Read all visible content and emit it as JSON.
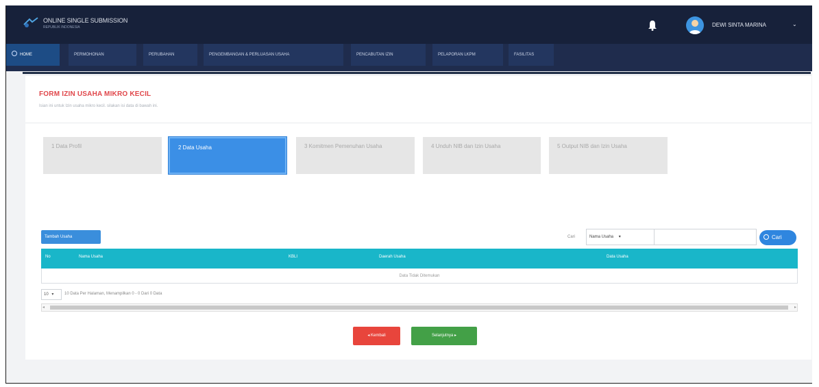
{
  "header": {
    "logo_title": "ONLINE SINGLE SUBMISSION",
    "logo_subtitle": "REPUBLIK INDONESIA",
    "user_name": "DEWI SINTA MARINA",
    "user_caret": "⌄"
  },
  "nav": {
    "items": [
      {
        "label": "HOME"
      },
      {
        "label": "PERMOHONAN"
      },
      {
        "label": "PERUBAHAN"
      },
      {
        "label": "PENGEMBANGAN & PERLUASAN USAHA"
      },
      {
        "label": "PENCABUTAN IZIN"
      },
      {
        "label": "PELAPORAN LKPM"
      },
      {
        "label": "FASILITAS"
      }
    ]
  },
  "form": {
    "title": "FORM IZIN USAHA MIKRO KECIL",
    "subtitle": "Isian ini untuk Izin usaha mikro kecil. silakan isi data di bawah ini."
  },
  "steps": [
    {
      "label": "1 Data Profil",
      "active": false
    },
    {
      "label": "2 Data Usaha",
      "active": true
    },
    {
      "label": "3 Komitmen Pemenuhan Usaha",
      "active": false
    },
    {
      "label": "4 Unduh NIB dan Izin Usaha",
      "active": false
    },
    {
      "label": "5 Output NIB dan Izin Usaha",
      "active": false
    }
  ],
  "toolbar": {
    "add_label": "Tambah Usaha",
    "search_label": "Cari",
    "search_select": "Nama Usaha",
    "search_select_caret": "▾",
    "search_placeholder": "",
    "search_button": "Cari"
  },
  "table": {
    "columns": [
      "No",
      "Nama Usaha",
      "KBLI",
      "Daerah Usaha",
      "Data Usaha"
    ],
    "empty_text": "Data Tidak Ditemukan"
  },
  "pager": {
    "page_size": "10",
    "page_size_caret": "▾",
    "info": "10 Data Per Halaman, Menampilkan 0 - 0 Dari 0 Data",
    "scroll_left": "◂",
    "scroll_right": "▸"
  },
  "actions": {
    "back_label": "◂ Kembali",
    "next_label": "Selanjutnya ▸"
  },
  "colors": {
    "topbar": "#17213a",
    "navbar": "#1f2c4d",
    "title_red": "#e0464a",
    "active_step": "#3b8fe6",
    "table_header": "#19b6c9",
    "back_button": "#e8453c",
    "next_button": "#43a047"
  }
}
